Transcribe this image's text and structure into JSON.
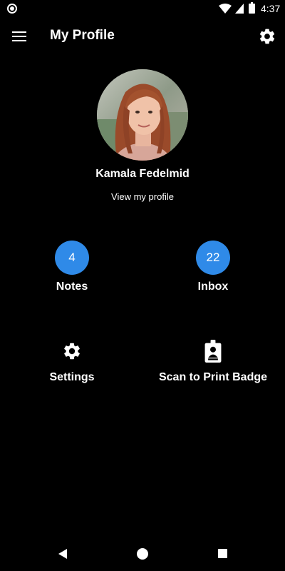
{
  "status_bar": {
    "time": "4:37"
  },
  "app_bar": {
    "title": "My Profile"
  },
  "profile": {
    "name": "Kamala Fedelmid",
    "link": "View my profile"
  },
  "tiles": [
    {
      "count": "4",
      "label": "Notes"
    },
    {
      "count": "22",
      "label": "Inbox"
    },
    {
      "label": "Settings",
      "icon": "gear-icon"
    },
    {
      "label": "Scan to Print Badge",
      "icon": "badge-icon"
    }
  ],
  "colors": {
    "background": "#000000",
    "accent": "#2f8ae8",
    "text": "#ffffff"
  }
}
